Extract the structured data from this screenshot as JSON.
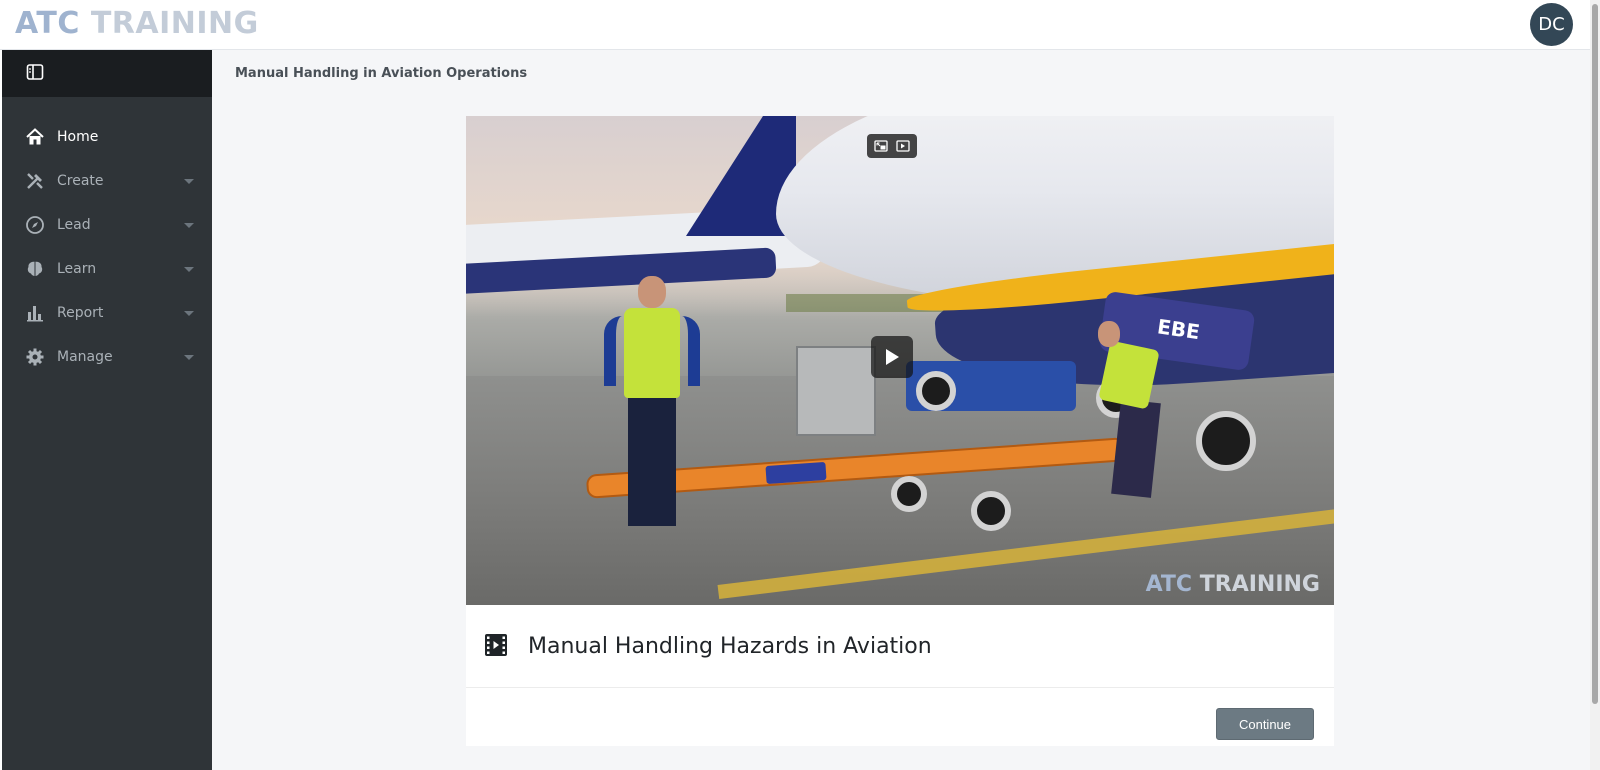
{
  "app": {
    "logo_part1": "ATC",
    "logo_part2": "TRAINING",
    "avatar_initials": "DC"
  },
  "sidebar": {
    "items": [
      {
        "label": "Home",
        "icon": "home-icon",
        "active": true
      },
      {
        "label": "Create",
        "icon": "tools-icon",
        "active": false
      },
      {
        "label": "Lead",
        "icon": "compass-icon",
        "active": false
      },
      {
        "label": "Learn",
        "icon": "brain-icon",
        "active": false
      },
      {
        "label": "Report",
        "icon": "bar-chart-icon",
        "active": false
      },
      {
        "label": "Manage",
        "icon": "gear-icon",
        "active": false
      }
    ]
  },
  "main": {
    "breadcrumb": "Manual Handling in Aviation Operations",
    "video": {
      "watermark_part1": "ATC",
      "watermark_part2": "TRAINING",
      "bag_text": "EBE"
    },
    "lesson_title": "Manual Handling Hazards in Aviation",
    "continue_label": "Continue"
  },
  "colors": {
    "sidebar_bg": "#2f3438",
    "sidebar_head_bg": "#1a1d20",
    "avatar_bg": "#334756",
    "button_bg": "#6c7a83"
  }
}
